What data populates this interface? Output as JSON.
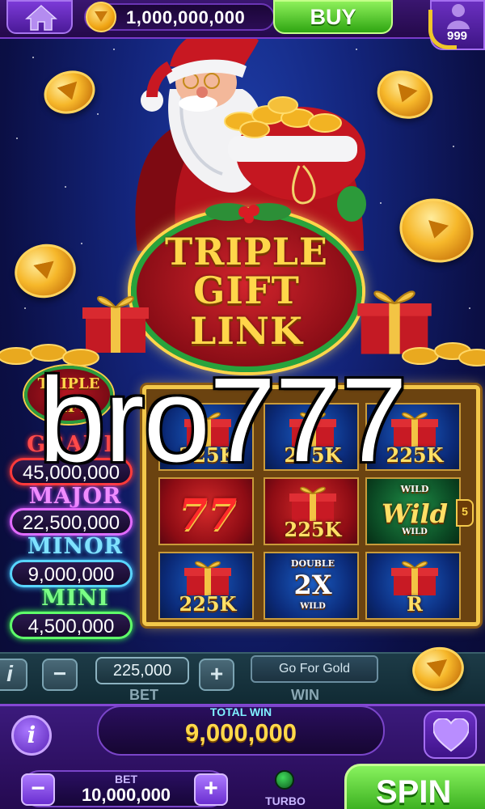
{
  "topbar": {
    "coin_balance": "1,000,000,000",
    "buy_label": "BUY",
    "level": "999"
  },
  "banner": {
    "logo_line1": "TRIPLE",
    "logo_line2": "GIFT",
    "logo_line3": "LINK"
  },
  "jackpots": {
    "logo_line1": "TRIPLE",
    "logo_line2": "GIFT",
    "grand": {
      "title": "GRAND",
      "value": "45,000,000",
      "color": "#ff3a3a"
    },
    "major": {
      "title": "MAJOR",
      "value": "22,500,000",
      "color": "#e36bff"
    },
    "minor": {
      "title": "MINOR",
      "value": "9,000,000",
      "color": "#58d5ff"
    },
    "mini": {
      "title": "MINI",
      "value": "4,500,000",
      "color": "#5fff6a"
    }
  },
  "reels": {
    "cells": [
      {
        "label": "225K",
        "type": "gift",
        "bg": "blue"
      },
      {
        "label": "225K",
        "type": "gift",
        "bg": "blue"
      },
      {
        "label": "225K",
        "type": "gift",
        "bg": "blue"
      },
      {
        "label": "77",
        "type": "seven",
        "bg": "red"
      },
      {
        "label": "225K",
        "type": "gift",
        "bg": "red"
      },
      {
        "label": "Wild",
        "type": "wild",
        "bg": "green",
        "small_top": "WILD",
        "small_bottom": "WILD"
      },
      {
        "label": "225K",
        "type": "gift",
        "bg": "blue"
      },
      {
        "label": "2X",
        "type": "multiplier",
        "bg": "blue",
        "small_top": "DOUBLE",
        "small_bottom": "WILD"
      },
      {
        "label": "R",
        "type": "gift",
        "bg": "blue"
      }
    ],
    "side_number": "5"
  },
  "watermark": "bro777",
  "controls": {
    "minus": "−",
    "bet_display": "225,000",
    "plus": "+",
    "go_for_gold": "Go For Gold",
    "bet_faded": "BET",
    "win_faded": "WIN"
  },
  "bottom": {
    "total_win_label": "TOTAL WIN",
    "total_win_value": "9,000,000",
    "bet_label": "BET",
    "bet_value": "10,000,000",
    "minus": "−",
    "plus": "+",
    "turbo_label": "TURBO",
    "spin_label": "SPIN",
    "info_label": "i"
  },
  "colors": {
    "accent_purple": "#7a45c9",
    "buy_green": "#2fa512",
    "gold": "#ffd84a"
  },
  "icons": [
    "home-icon",
    "coin-icon",
    "profile-icon",
    "info-icon",
    "heart-icon",
    "turbo-indicator-icon"
  ]
}
